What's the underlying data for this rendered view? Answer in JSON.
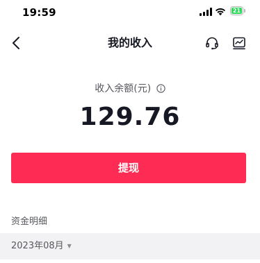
{
  "status_bar": {
    "time": "19:59",
    "battery_level": "21",
    "battery_color": "#2bd95b"
  },
  "nav": {
    "title": "我的收入",
    "back_icon": "chevron-left-icon",
    "support_icon": "headset-icon",
    "chart_icon": "trend-chart-icon"
  },
  "balance": {
    "label": "收入余额(元)",
    "info_icon": "info-icon",
    "amount": "129.76"
  },
  "withdraw": {
    "label": "提现",
    "color": "#fe2c55"
  },
  "details": {
    "title": "资金明细",
    "month": "2023年08月",
    "caret": "▼"
  }
}
